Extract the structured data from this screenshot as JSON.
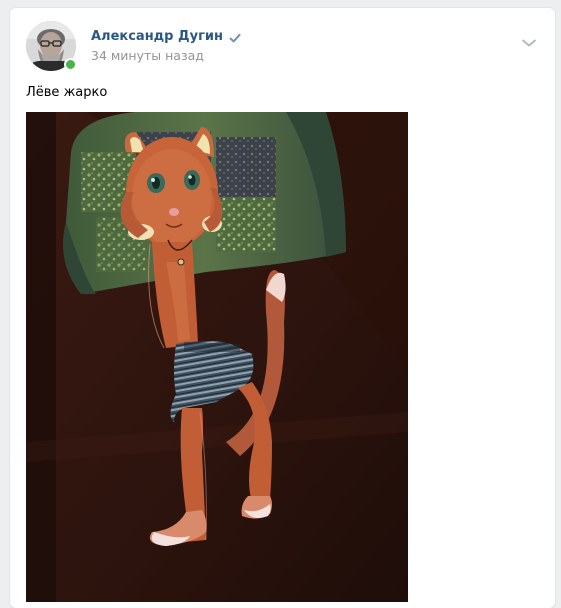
{
  "post": {
    "author_name": "Александр Дугин",
    "verified": true,
    "time": "34 минуты назад",
    "text": "Лёве жарко"
  },
  "icons": {
    "verified": "verified-checkmark-icon",
    "options": "chevron-down-icon",
    "online": "online-status-dot"
  },
  "colors": {
    "author": "#2a5885",
    "verified": "#6d93b8",
    "online": "#4bb34b",
    "meta": "#939393",
    "background": "#edeef0"
  }
}
